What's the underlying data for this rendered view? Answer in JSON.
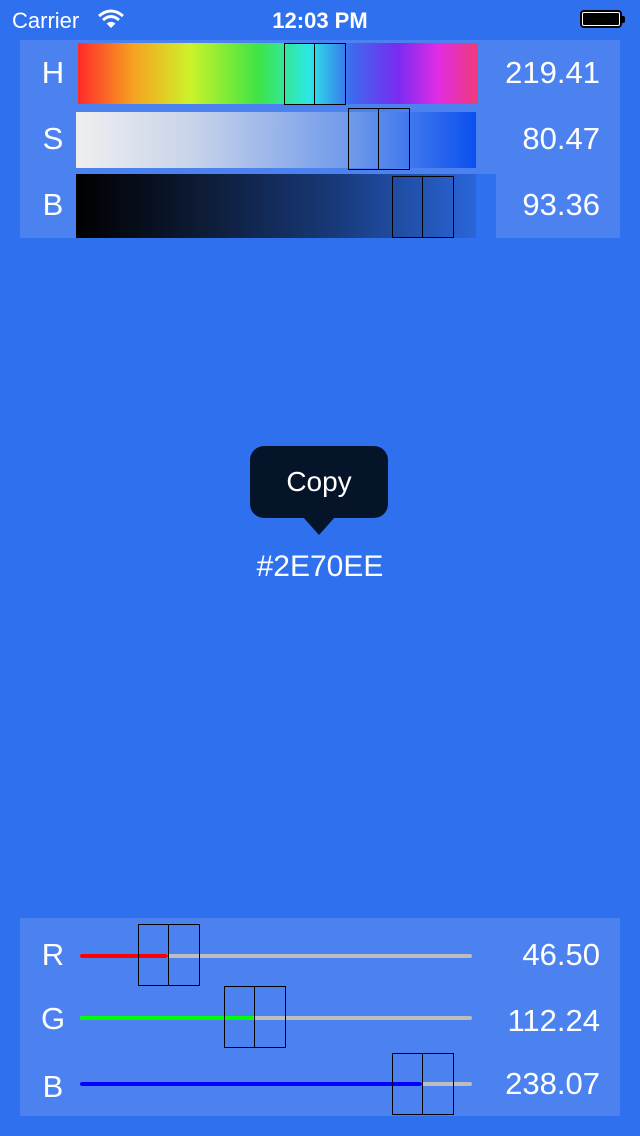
{
  "status_bar": {
    "carrier": "Carrier",
    "time": "12:03 PM"
  },
  "hsb": {
    "hue": {
      "label": "H",
      "value": "219.41",
      "fraction": 0.609
    },
    "saturation": {
      "label": "S",
      "value": "80.47",
      "fraction": 0.805
    },
    "brightness": {
      "label": "B",
      "value": "93.36",
      "fraction": 0.934
    }
  },
  "color": {
    "hex": "#2E70EE",
    "copy_label": "Copy"
  },
  "rgb": {
    "red": {
      "label": "R",
      "value": "46.50",
      "fraction": 0.182,
      "color": "#FF0000"
    },
    "green": {
      "label": "G",
      "value": "112.24",
      "fraction": 0.44,
      "color": "#00FF00"
    },
    "blue": {
      "label": "B",
      "value": "238.07",
      "fraction": 0.934,
      "color": "#0000FF"
    }
  },
  "colors": {
    "background": "#2E70EE",
    "panel": "#4B82F0",
    "callout": "#061429",
    "track": "#BDBDBD"
  }
}
